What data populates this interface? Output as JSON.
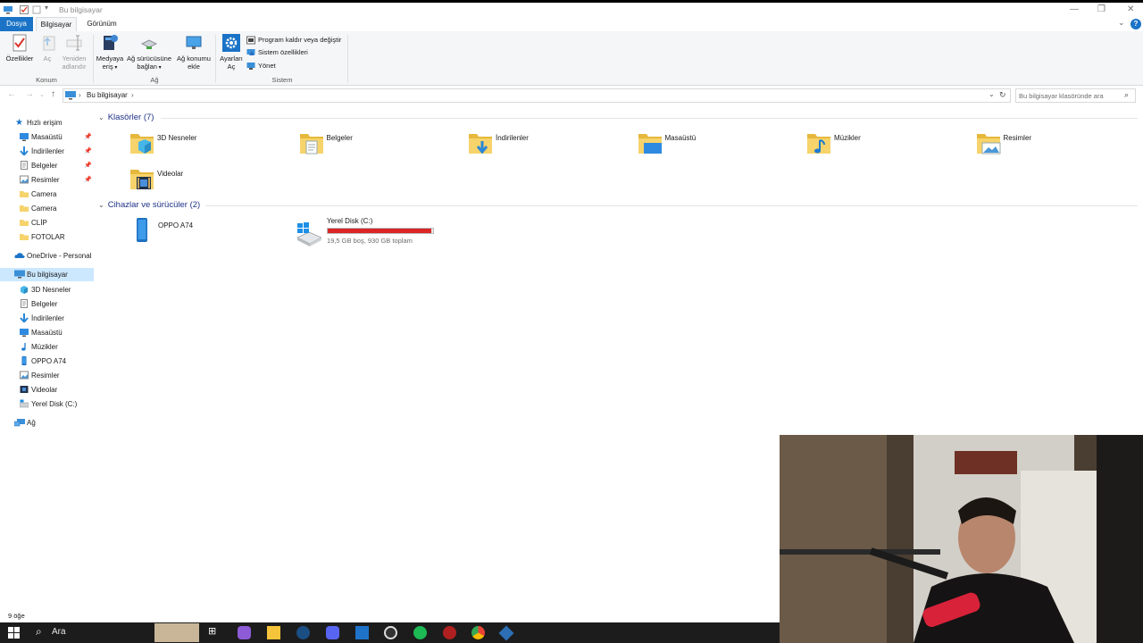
{
  "window": {
    "title": "Bu bilgisayar"
  },
  "menu_tabs": {
    "file": "Dosya",
    "computer": "Bilgisayar",
    "view": "Görünüm"
  },
  "ribbon": {
    "location_group": {
      "label": "Konum",
      "properties": "Özellikler",
      "open": "Aç",
      "rename": "Yeniden adlandır"
    },
    "network_group": {
      "label": "Ağ",
      "media": "Medyaya eriş",
      "map_drive": "Ağ sürücüsüne bağlan",
      "add_location": "Ağ konumu ekle"
    },
    "system_group": {
      "label": "Sistem",
      "open_settings": "Ayarları Aç",
      "uninstall": "Program kaldır veya değiştir",
      "system_properties": "Sistem özellikleri",
      "manage": "Yönet"
    }
  },
  "address": {
    "crumb": "Bu bilgisayar",
    "search_placeholder": "Bu bilgisayar klasöründe ara"
  },
  "nav": {
    "quick_access": "Hızlı erişim",
    "quick_items": [
      {
        "label": "Masaüstü",
        "pinned": true,
        "icon": "desktop-icon"
      },
      {
        "label": "İndirilenler",
        "pinned": true,
        "icon": "download-icon"
      },
      {
        "label": "Belgeler",
        "pinned": true,
        "icon": "documents-icon"
      },
      {
        "label": "Resimler",
        "pinned": true,
        "icon": "pictures-icon"
      },
      {
        "label": "Camera",
        "pinned": false,
        "icon": "folder-icon"
      },
      {
        "label": "Camera",
        "pinned": false,
        "icon": "folder-icon"
      },
      {
        "label": "CLİP",
        "pinned": false,
        "icon": "folder-icon"
      },
      {
        "label": "FOTOLAR",
        "pinned": false,
        "icon": "folder-icon"
      }
    ],
    "onedrive": "OneDrive - Personal",
    "this_pc": "Bu bilgisayar",
    "pc_items": [
      {
        "label": "3D Nesneler",
        "icon": "3d-objects-icon"
      },
      {
        "label": "Belgeler",
        "icon": "documents-icon"
      },
      {
        "label": "İndirilenler",
        "icon": "download-icon"
      },
      {
        "label": "Masaüstü",
        "icon": "desktop-icon"
      },
      {
        "label": "Müzikler",
        "icon": "music-icon"
      },
      {
        "label": "OPPO A74",
        "icon": "phone-icon"
      },
      {
        "label": "Resimler",
        "icon": "pictures-icon"
      },
      {
        "label": "Videolar",
        "icon": "videos-icon"
      },
      {
        "label": "Yerel Disk (C:)",
        "icon": "disk-icon"
      }
    ],
    "network": "Ağ"
  },
  "content": {
    "folders_header": "Klasörler (7)",
    "folders": [
      {
        "label": "3D Nesneler",
        "icon": "3d-objects-icon"
      },
      {
        "label": "Belgeler",
        "icon": "documents-icon"
      },
      {
        "label": "İndirilenler",
        "icon": "download-icon"
      },
      {
        "label": "Masaüstü",
        "icon": "desktop-icon"
      },
      {
        "label": "Müzikler",
        "icon": "music-icon"
      },
      {
        "label": "Resimler",
        "icon": "pictures-icon"
      },
      {
        "label": "Videolar",
        "icon": "videos-icon"
      }
    ],
    "devices_header": "Cihazlar ve sürücüler (2)",
    "devices": {
      "phone": "OPPO A74",
      "disk": {
        "label": "Yerel Disk (C:)",
        "free_text": "19,5 GB boş, 930 GB toplam",
        "used_fraction": 0.979
      }
    }
  },
  "status": {
    "item_count": "9 öğe"
  },
  "taskbar": {
    "search_label": "Ara"
  },
  "colors": {
    "accent": "#1a73c6",
    "selection": "#cce8ff",
    "disk_fill_full": "#da2626",
    "section_header": "#1e3287",
    "folder_yellow": "#f6d36b"
  }
}
